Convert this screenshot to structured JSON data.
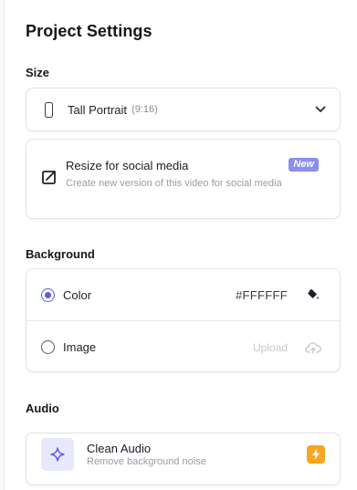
{
  "panel": {
    "title": "Project Settings"
  },
  "size": {
    "label": "Size",
    "dropdown": {
      "value": "Tall Portrait",
      "ratio": "(9:16)",
      "icon": "phone-portrait-icon"
    },
    "resize": {
      "title": "Resize for social media",
      "description": "Create new version of this video for social media",
      "badge": "New",
      "icon": "resize-arrow-icon"
    }
  },
  "background": {
    "label": "Background",
    "options": [
      {
        "label": "Color",
        "selected": true,
        "value": "#FFFFFF"
      },
      {
        "label": "Image",
        "selected": false,
        "action": "Upload"
      }
    ]
  },
  "audio": {
    "label": "Audio",
    "clean": {
      "title": "Clean Audio",
      "description": "Remove background noise",
      "icon": "sparkle-icon",
      "badge_icon": "lightning-icon"
    }
  },
  "colors": {
    "accent": "#5b5bea",
    "badge_new": "#8b8df0",
    "badge_bolt": "#f6a623",
    "audio_icon_bg": "#e7e8fb"
  }
}
